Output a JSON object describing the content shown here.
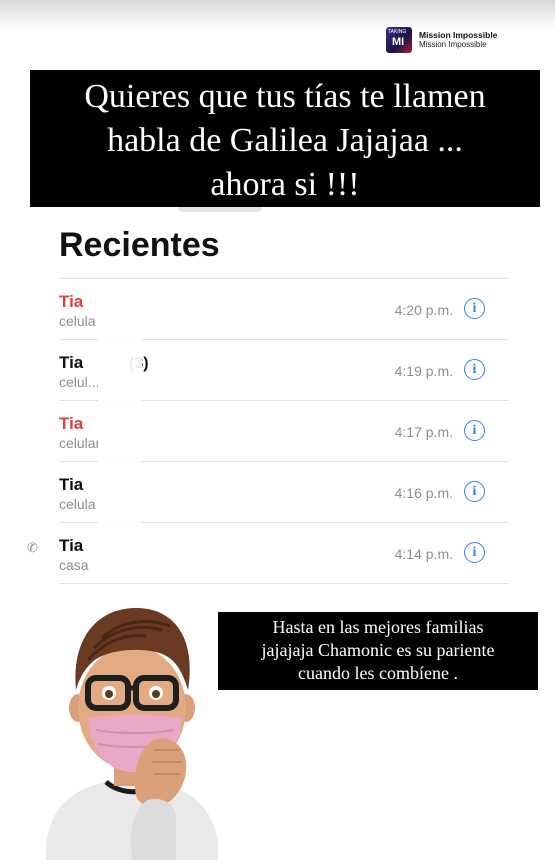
{
  "music": {
    "title": "Mission Impossible",
    "artist": "Mission Impossible",
    "album_label": "TAKING",
    "album_mark": "MI"
  },
  "banner": {
    "lines": [
      "Quieres que tus tías te llamen",
      "habla de Galilea Jajajaa ...",
      "ahora si !!!"
    ]
  },
  "recents": {
    "title": "Recientes",
    "calls": [
      {
        "name": "Tia",
        "count": "",
        "type": "celula",
        "time": "4:20 p.m.",
        "missed": true,
        "outgoing": false
      },
      {
        "name": "Tia",
        "count": "(3)",
        "type": "celul...",
        "time": "4:19 p.m.",
        "missed": false,
        "outgoing": false
      },
      {
        "name": "Tia",
        "count": "",
        "type": "celular",
        "time": "4:17 p.m.",
        "missed": true,
        "outgoing": false
      },
      {
        "name": "Tia",
        "count": "",
        "type": "celula",
        "time": "4:16 p.m.",
        "missed": false,
        "outgoing": false
      },
      {
        "name": "Tia",
        "count": "",
        "type": "casa",
        "time": "4:14 p.m.",
        "missed": false,
        "outgoing": true
      }
    ],
    "info_icon": "info-circle-icon",
    "phone_icon": "phone-outgoing-icon"
  },
  "caption": {
    "lines": [
      "Hasta en las mejores familias",
      "jajajaja  Chamonic es su pariente",
      "cuando les combíene ."
    ]
  },
  "colors": {
    "missed": "#e0413b",
    "info": "#2f7ff7",
    "secondary": "#8e8e93"
  }
}
